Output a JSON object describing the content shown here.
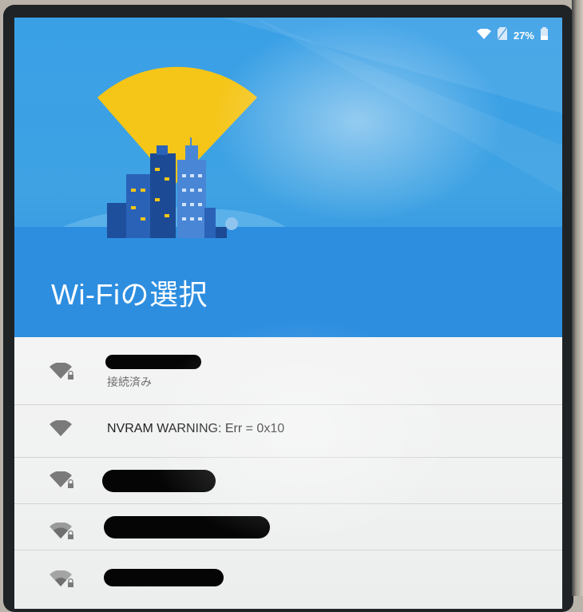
{
  "status_bar": {
    "battery_percent": "27%",
    "icons": [
      "wifi-signal-icon",
      "no-sim-icon",
      "battery-icon"
    ]
  },
  "header": {
    "title": "Wi-Fiの選択"
  },
  "networks": [
    {
      "ssid": "",
      "status": "接続済み",
      "secured": true,
      "redacted": true
    },
    {
      "ssid": "NVRAM WARNING: Err = 0x10",
      "status": "",
      "secured": false,
      "redacted": false
    },
    {
      "ssid": "",
      "status": "",
      "secured": true,
      "redacted": true
    },
    {
      "ssid": "",
      "status": "",
      "secured": true,
      "redacted": true
    },
    {
      "ssid": "",
      "status": "",
      "secured": true,
      "redacted": true
    }
  ],
  "colors": {
    "header_blue": "#3aa0e6",
    "header_band": "#2f8fe0",
    "signal_fan": "#f5c518",
    "list_background": "#f2f2f2"
  }
}
